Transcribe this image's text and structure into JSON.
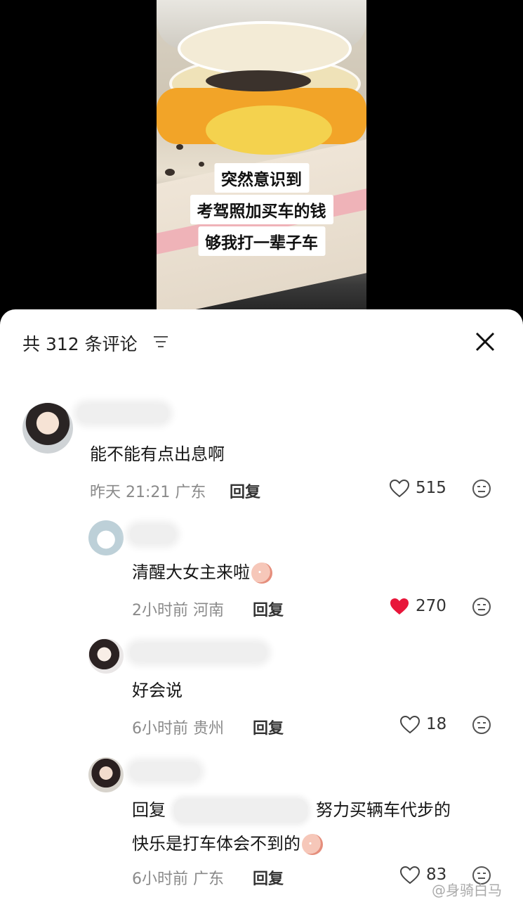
{
  "video": {
    "caption_lines": [
      "突然意识到",
      "考驾照加买车的钱",
      "够我打一辈子车"
    ]
  },
  "comments_panel": {
    "title": "共 312 条评论",
    "filter_icon": "filter-icon",
    "close_icon": "close-icon"
  },
  "comments": [
    {
      "text": "能不能有点出息啊",
      "time": "昨天 21:21",
      "location": "广东",
      "reply_label": "回复",
      "likes": "515",
      "liked": false
    },
    {
      "text": "清醒大女主来啦",
      "time": "2小时前",
      "location": "河南",
      "reply_label": "回复",
      "likes": "270",
      "liked": true
    },
    {
      "text": "好会说",
      "time": "6小时前",
      "location": "贵州",
      "reply_label": "回复",
      "likes": "18",
      "liked": false
    },
    {
      "text_prefix": "回复",
      "text_after": "努力买辆车代步的",
      "text_line2": "快乐是打车体会不到的",
      "time": "6小时前",
      "location": "广东",
      "reply_label": "回复",
      "likes": "83",
      "liked": false
    }
  ],
  "watermark": "@身骑白马",
  "colors": {
    "liked_heart": "#e8163a"
  }
}
